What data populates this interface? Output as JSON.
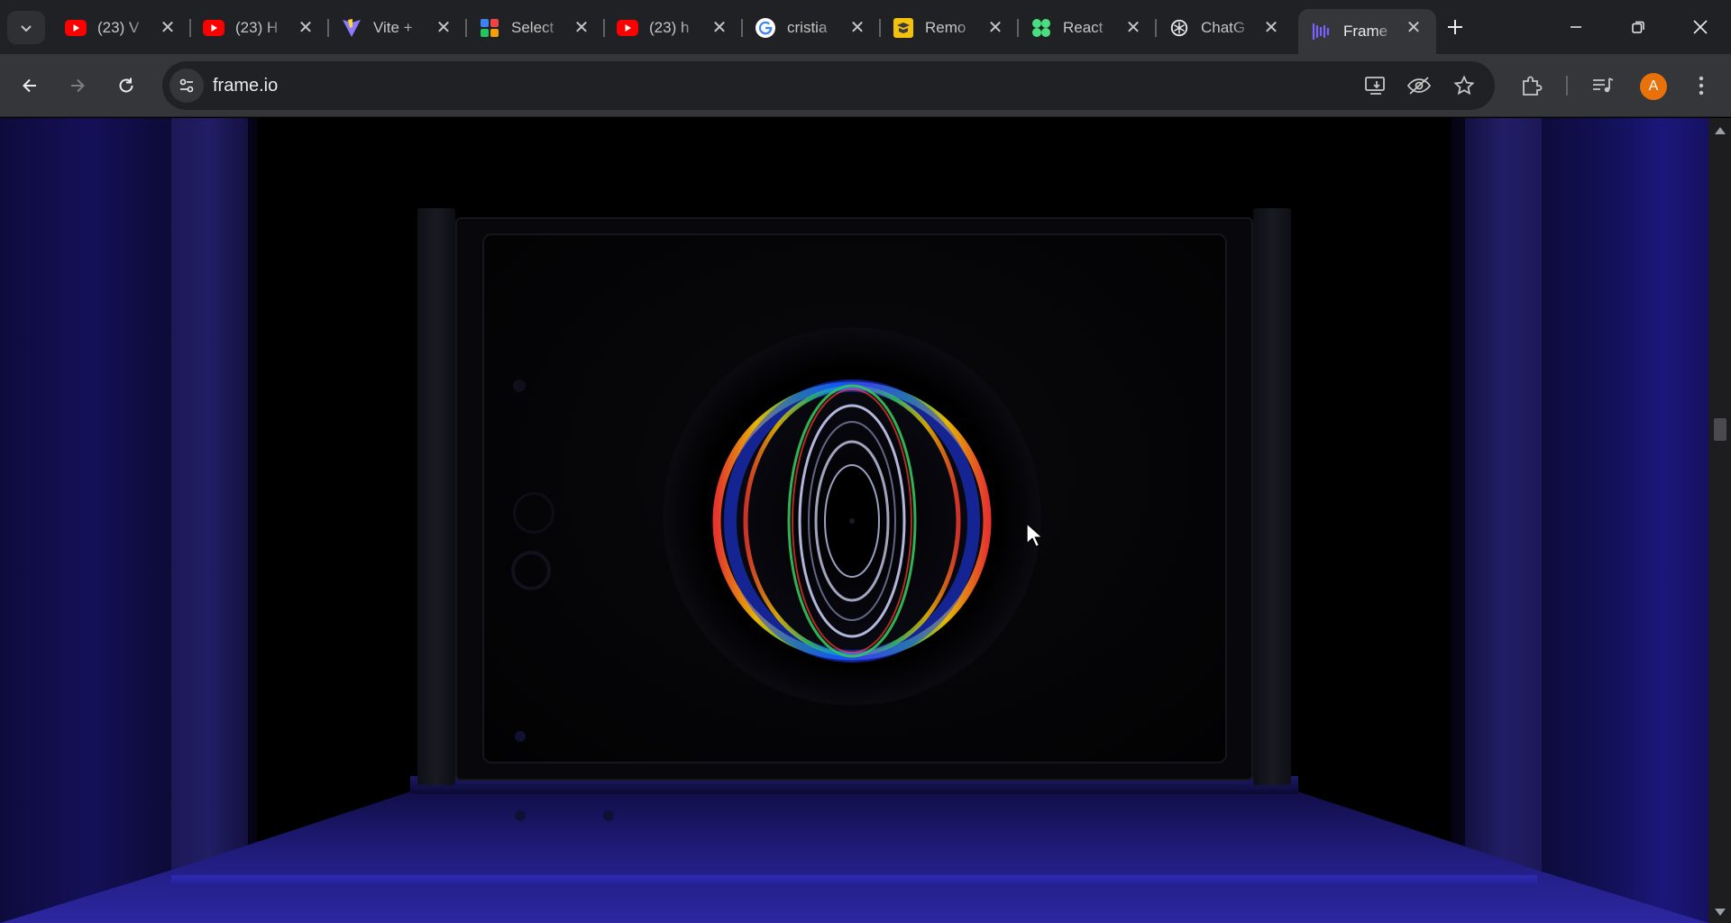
{
  "tabs": [
    {
      "title": "(23) V",
      "favicon": "youtube-icon",
      "color": "#ff0000"
    },
    {
      "title": "(23) H",
      "favicon": "youtube-icon",
      "color": "#ff0000"
    },
    {
      "title": "Vite +",
      "favicon": "vite-icon",
      "color": "#bd34fe"
    },
    {
      "title": "Select",
      "favicon": "select-icon",
      "color": "#3b82f6"
    },
    {
      "title": "(23) h",
      "favicon": "youtube-icon",
      "color": "#ff0000"
    },
    {
      "title": "cristia",
      "favicon": "google-icon",
      "color": "#4285f4"
    },
    {
      "title": "Remo",
      "favicon": "remotion-icon",
      "color": "#f4c20d"
    },
    {
      "title": "React",
      "favicon": "react-flow-icon",
      "color": "#4ade80"
    },
    {
      "title": "ChatG",
      "favicon": "chatgpt-icon",
      "color": "#e8eaed"
    },
    {
      "title": "Frame",
      "favicon": "frameio-icon",
      "color": "#7b61ff",
      "active": true
    }
  ],
  "toolbar": {
    "url": "frame.io",
    "profile_initial": "A",
    "profile_color": "#e8710a"
  },
  "colors": {
    "tabstrip_bg": "#202124",
    "toolbar_bg": "#35363a",
    "omnibox_bg": "#202124",
    "wall_blue": "#1b177a",
    "floor_blue": "#2c27a0"
  }
}
